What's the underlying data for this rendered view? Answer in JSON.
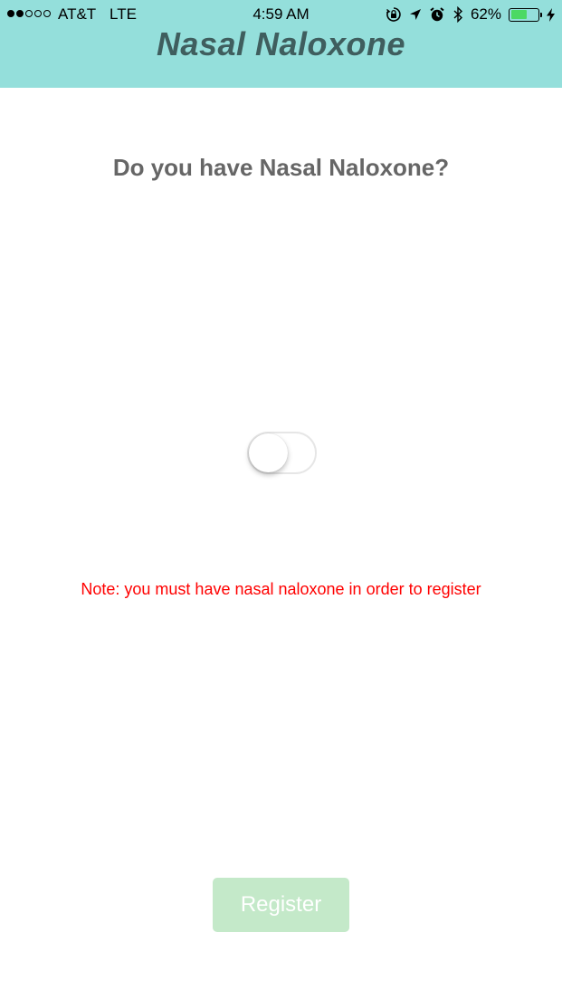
{
  "status_bar": {
    "signal_bars_filled": 2,
    "signal_bars_total": 5,
    "carrier": "AT&T",
    "network": "LTE",
    "time": "4:59 AM",
    "icons": [
      "rotation-lock-icon",
      "location-arrow-icon",
      "alarm-icon",
      "bluetooth-icon"
    ],
    "battery_percent_label": "62%",
    "battery_level": 0.62,
    "battery_color": "#4cd964",
    "charging": true
  },
  "header": {
    "title": "Nasal Naloxone",
    "background_color": "#94dfdb",
    "title_color": "#3f5e5e"
  },
  "main": {
    "question": "Do you have Nasal Naloxone?",
    "toggle_on": false,
    "note": "Note: you must have nasal naloxone in order to register",
    "note_color": "#ff0000"
  },
  "register": {
    "label": "Register",
    "enabled": false,
    "background_color": "#c4e9c9"
  }
}
